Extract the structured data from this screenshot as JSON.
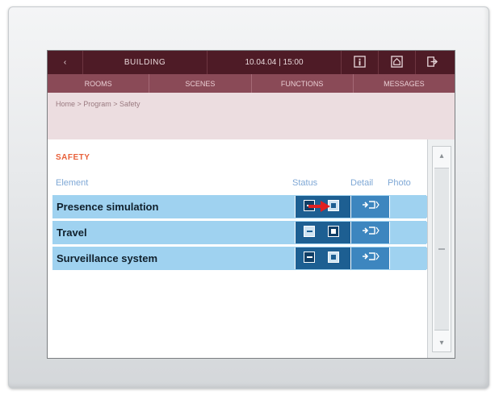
{
  "topbar": {
    "back": "‹",
    "building": "BUILDING",
    "datetime": "10.04.04 | 15:00"
  },
  "tabs": [
    {
      "label": "ROOMS"
    },
    {
      "label": "SCENES"
    },
    {
      "label": "FUNCTIONS"
    },
    {
      "label": "MESSAGES"
    }
  ],
  "breadcrumb": "Home > Program > Safety",
  "section": {
    "title": "SAFETY"
  },
  "columns": {
    "element": "Element",
    "status": "Status",
    "detail": "Detail",
    "photo": "Photo"
  },
  "rows": [
    {
      "name": "Presence simulation",
      "state": "off"
    },
    {
      "name": "Travel",
      "state": "on"
    },
    {
      "name": "Surveillance system",
      "state": "off"
    }
  ],
  "colors": {
    "topbar": "#4e1b26",
    "tabbar": "#8a4a57",
    "row": "#9fd2f0",
    "status": "#1d5f92",
    "accent": "#e8603a",
    "arrow": "#e02020"
  },
  "icons": {
    "topbar": [
      "info-icon",
      "home-icon",
      "exit-icon"
    ],
    "detail": "detail-arrow-icon",
    "pointer": "red-arrow-icon"
  }
}
